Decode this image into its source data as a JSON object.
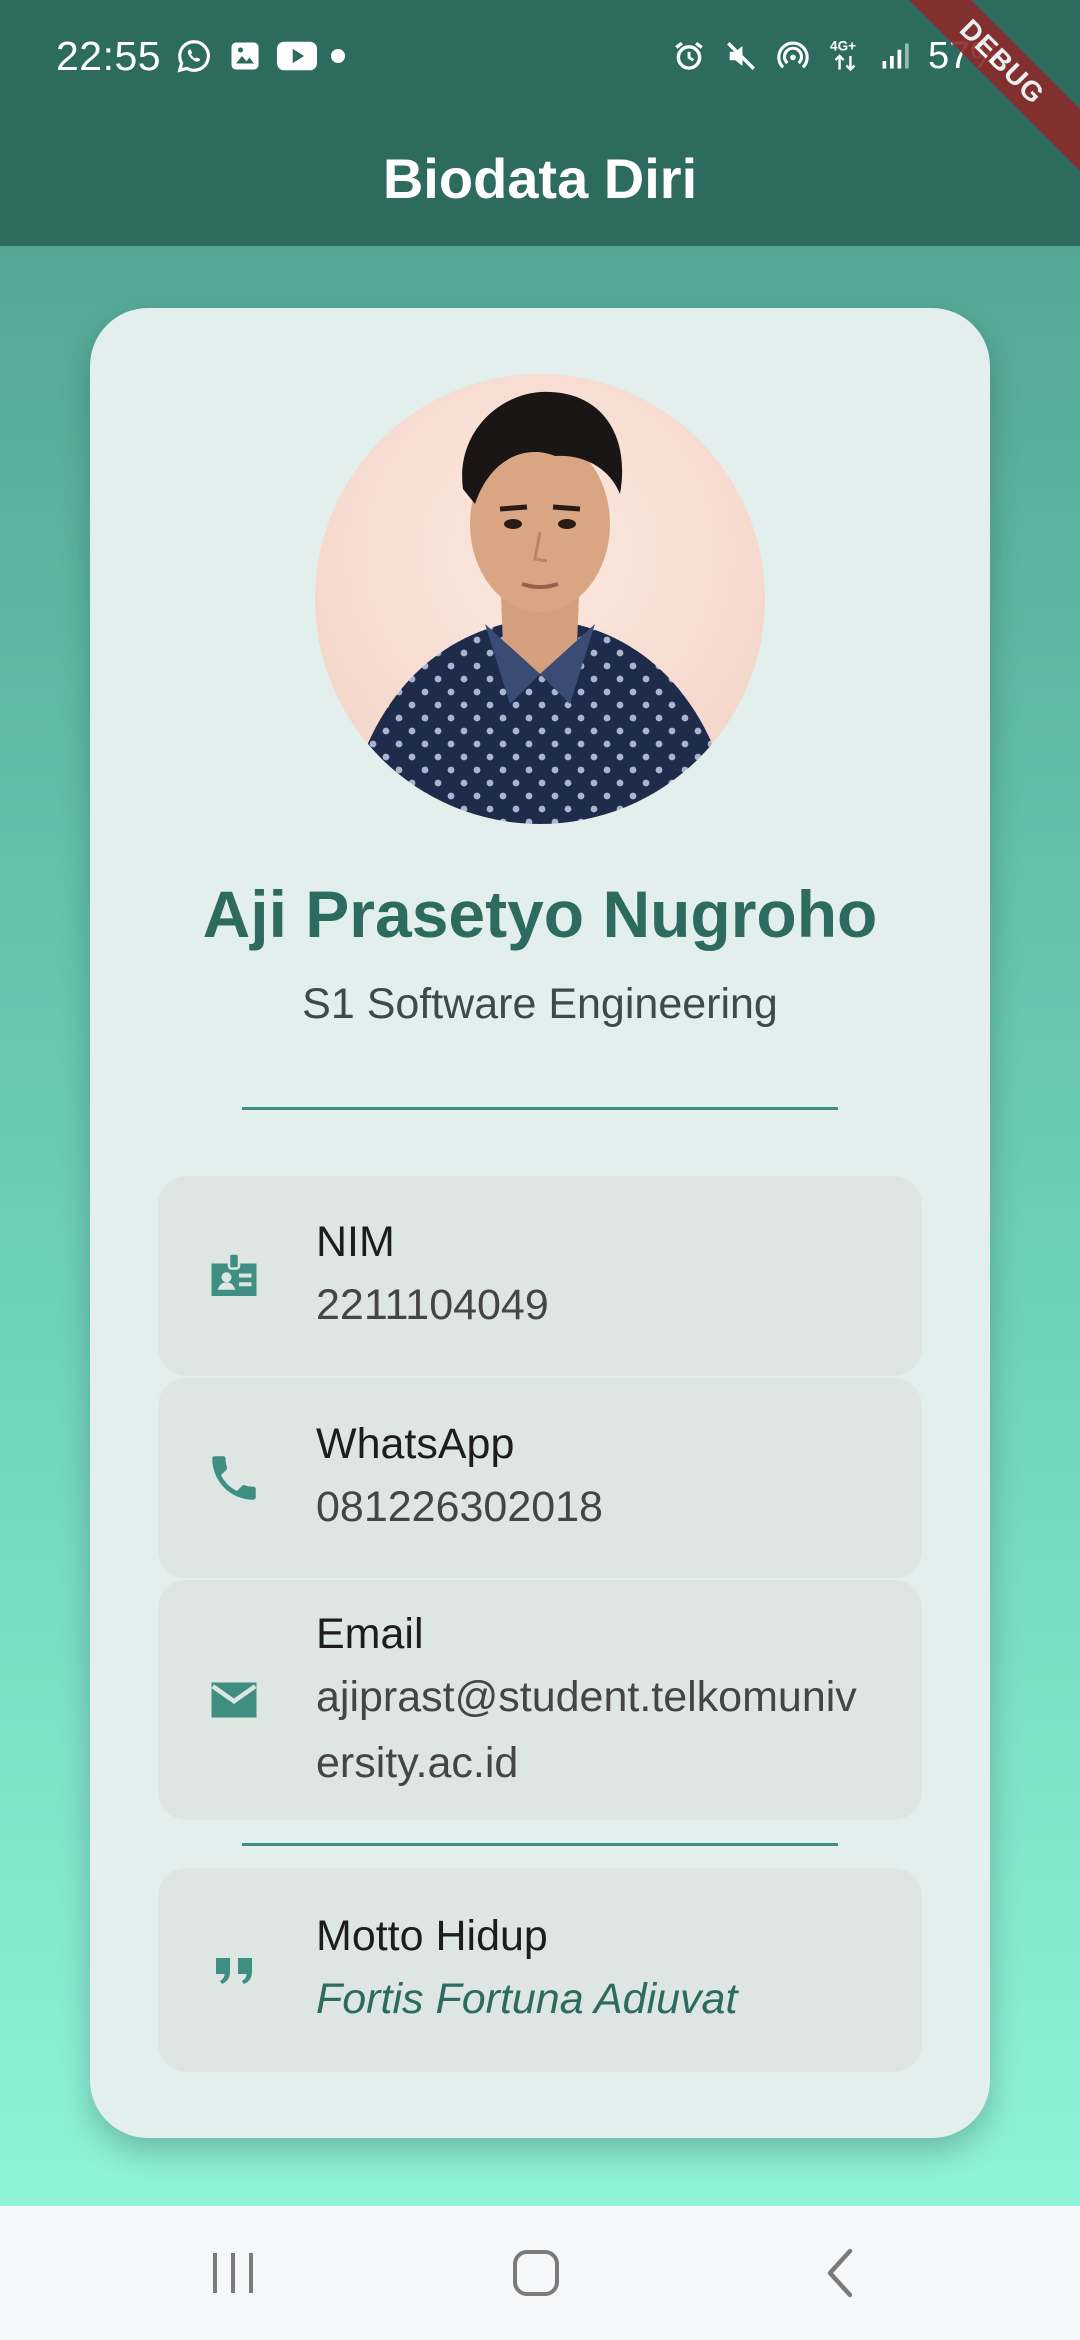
{
  "status_bar": {
    "time": "22:55",
    "battery": "57%",
    "left_icons": [
      "whatsapp-icon",
      "gallery-icon",
      "youtube-icon",
      "dot-icon"
    ],
    "right_icons": [
      "alarm-icon",
      "mute-icon",
      "hotspot-icon",
      "4g-icon",
      "signal-icon"
    ],
    "network_label": "4G+"
  },
  "debug_banner": "DEBUG",
  "app_bar": {
    "title": "Biodata Diri",
    "color": "#2d6b5f"
  },
  "profile": {
    "name": "Aji Prasetyo Nugroho",
    "program": "S1 Software Engineering"
  },
  "info": [
    {
      "icon": "id-badge-icon",
      "label": "NIM",
      "value": "2211104049"
    },
    {
      "icon": "phone-icon",
      "label": "WhatsApp",
      "value": "081226302018"
    },
    {
      "icon": "email-icon",
      "label": "Email",
      "value": "ajiprast@student.telkomuniversity.ac.id"
    }
  ],
  "motto": {
    "icon": "quote-icon",
    "label": "Motto Hidup",
    "value": "Fortis Fortuna Adiuvat"
  },
  "nav_bar": {
    "buttons": [
      "recents-icon",
      "home-icon",
      "back-icon"
    ]
  },
  "colors": {
    "primary": "#2d6b5f",
    "icon": "#3e8f82",
    "card": "#e2efec",
    "item": "#dde6e3"
  }
}
